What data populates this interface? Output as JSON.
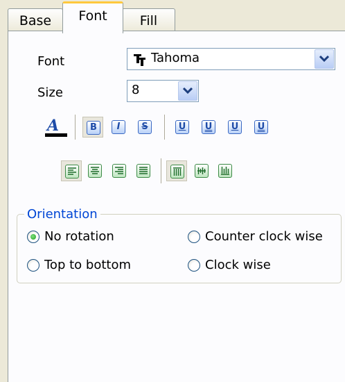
{
  "tabs": [
    {
      "label": "Base",
      "active": false
    },
    {
      "label": "Font",
      "active": true
    },
    {
      "label": "Fill",
      "active": false
    }
  ],
  "font": {
    "label": "Font",
    "value": "Tahoma",
    "icon": "truetype-font-icon"
  },
  "size": {
    "label": "Size",
    "value": "8"
  },
  "toolbar_style": {
    "font_color": {
      "icon": "font-color-icon",
      "color": "#000000"
    },
    "buttons": [
      {
        "name": "bold",
        "glyph": "B",
        "pressed": true
      },
      {
        "name": "italic",
        "glyph": "I",
        "pressed": false
      },
      {
        "name": "strikeout",
        "glyph": "S",
        "pressed": false
      },
      {
        "name": "underline-single",
        "glyph": "U",
        "pressed": false
      },
      {
        "name": "underline-double",
        "glyph": "U",
        "pressed": false
      },
      {
        "name": "underline-single-accounting",
        "glyph": "U",
        "pressed": false
      },
      {
        "name": "underline-double-accounting",
        "glyph": "U",
        "pressed": false
      }
    ]
  },
  "toolbar_align": {
    "horizontal": [
      {
        "name": "align-left",
        "pressed": true
      },
      {
        "name": "align-center",
        "pressed": false
      },
      {
        "name": "align-right",
        "pressed": false
      },
      {
        "name": "align-justify",
        "pressed": false
      }
    ],
    "vertical": [
      {
        "name": "valign-top",
        "pressed": true
      },
      {
        "name": "valign-center",
        "pressed": false
      },
      {
        "name": "valign-bottom",
        "pressed": false
      }
    ]
  },
  "orientation": {
    "legend": "Orientation",
    "options": [
      {
        "label": "No rotation",
        "checked": true
      },
      {
        "label": "Counter clock wise",
        "checked": false
      },
      {
        "label": "Top to bottom",
        "checked": false
      },
      {
        "label": "Clock wise",
        "checked": false
      }
    ]
  },
  "colors": {
    "window": "#ece9d8",
    "panel": "#fcfcfe",
    "tab_highlight": "#ffc83c",
    "group_legend": "#0046d5",
    "button_blue": "#1f4ca8",
    "button_green": "#3c8a46"
  }
}
